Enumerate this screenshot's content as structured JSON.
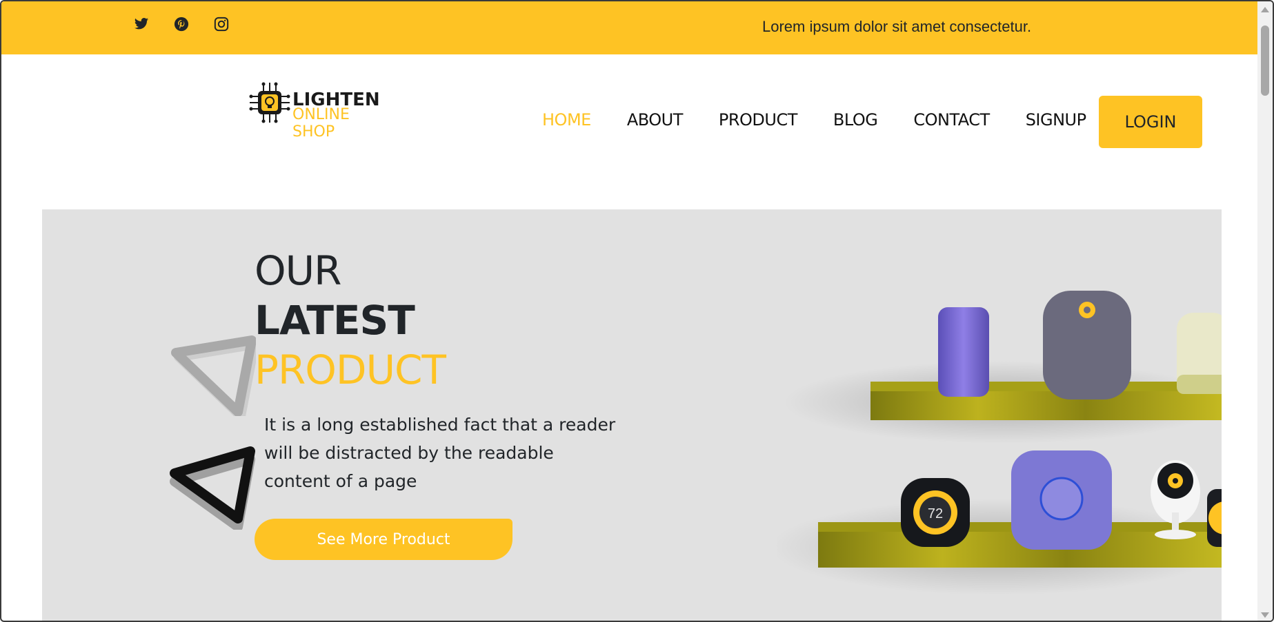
{
  "topbar": {
    "social": [
      {
        "name": "twitter-icon"
      },
      {
        "name": "pinterest-icon"
      },
      {
        "name": "instagram-icon"
      }
    ],
    "tagline": "Lorem ipsum dolor sit amet consectetur."
  },
  "logo": {
    "line1": "LIGHTEN",
    "line2": "ONLINE SHOP"
  },
  "nav": {
    "items": [
      "HOME",
      "ABOUT",
      "PRODUCT",
      "BLOG",
      "CONTACT",
      "SIGNUP"
    ],
    "active": "HOME",
    "login_label": "LOGIN"
  },
  "hero": {
    "title_line1": "OUR",
    "title_line2": "LATEST",
    "title_line3": "PRODUCT",
    "description": "It is a long established fact that a reader will be distracted by the readable content of a page",
    "cta_label": "See More Product",
    "thermostat_reading": "72"
  },
  "colors": {
    "accent": "#fec324",
    "text": "#212529",
    "hero_bg": "#e1e1e1"
  }
}
